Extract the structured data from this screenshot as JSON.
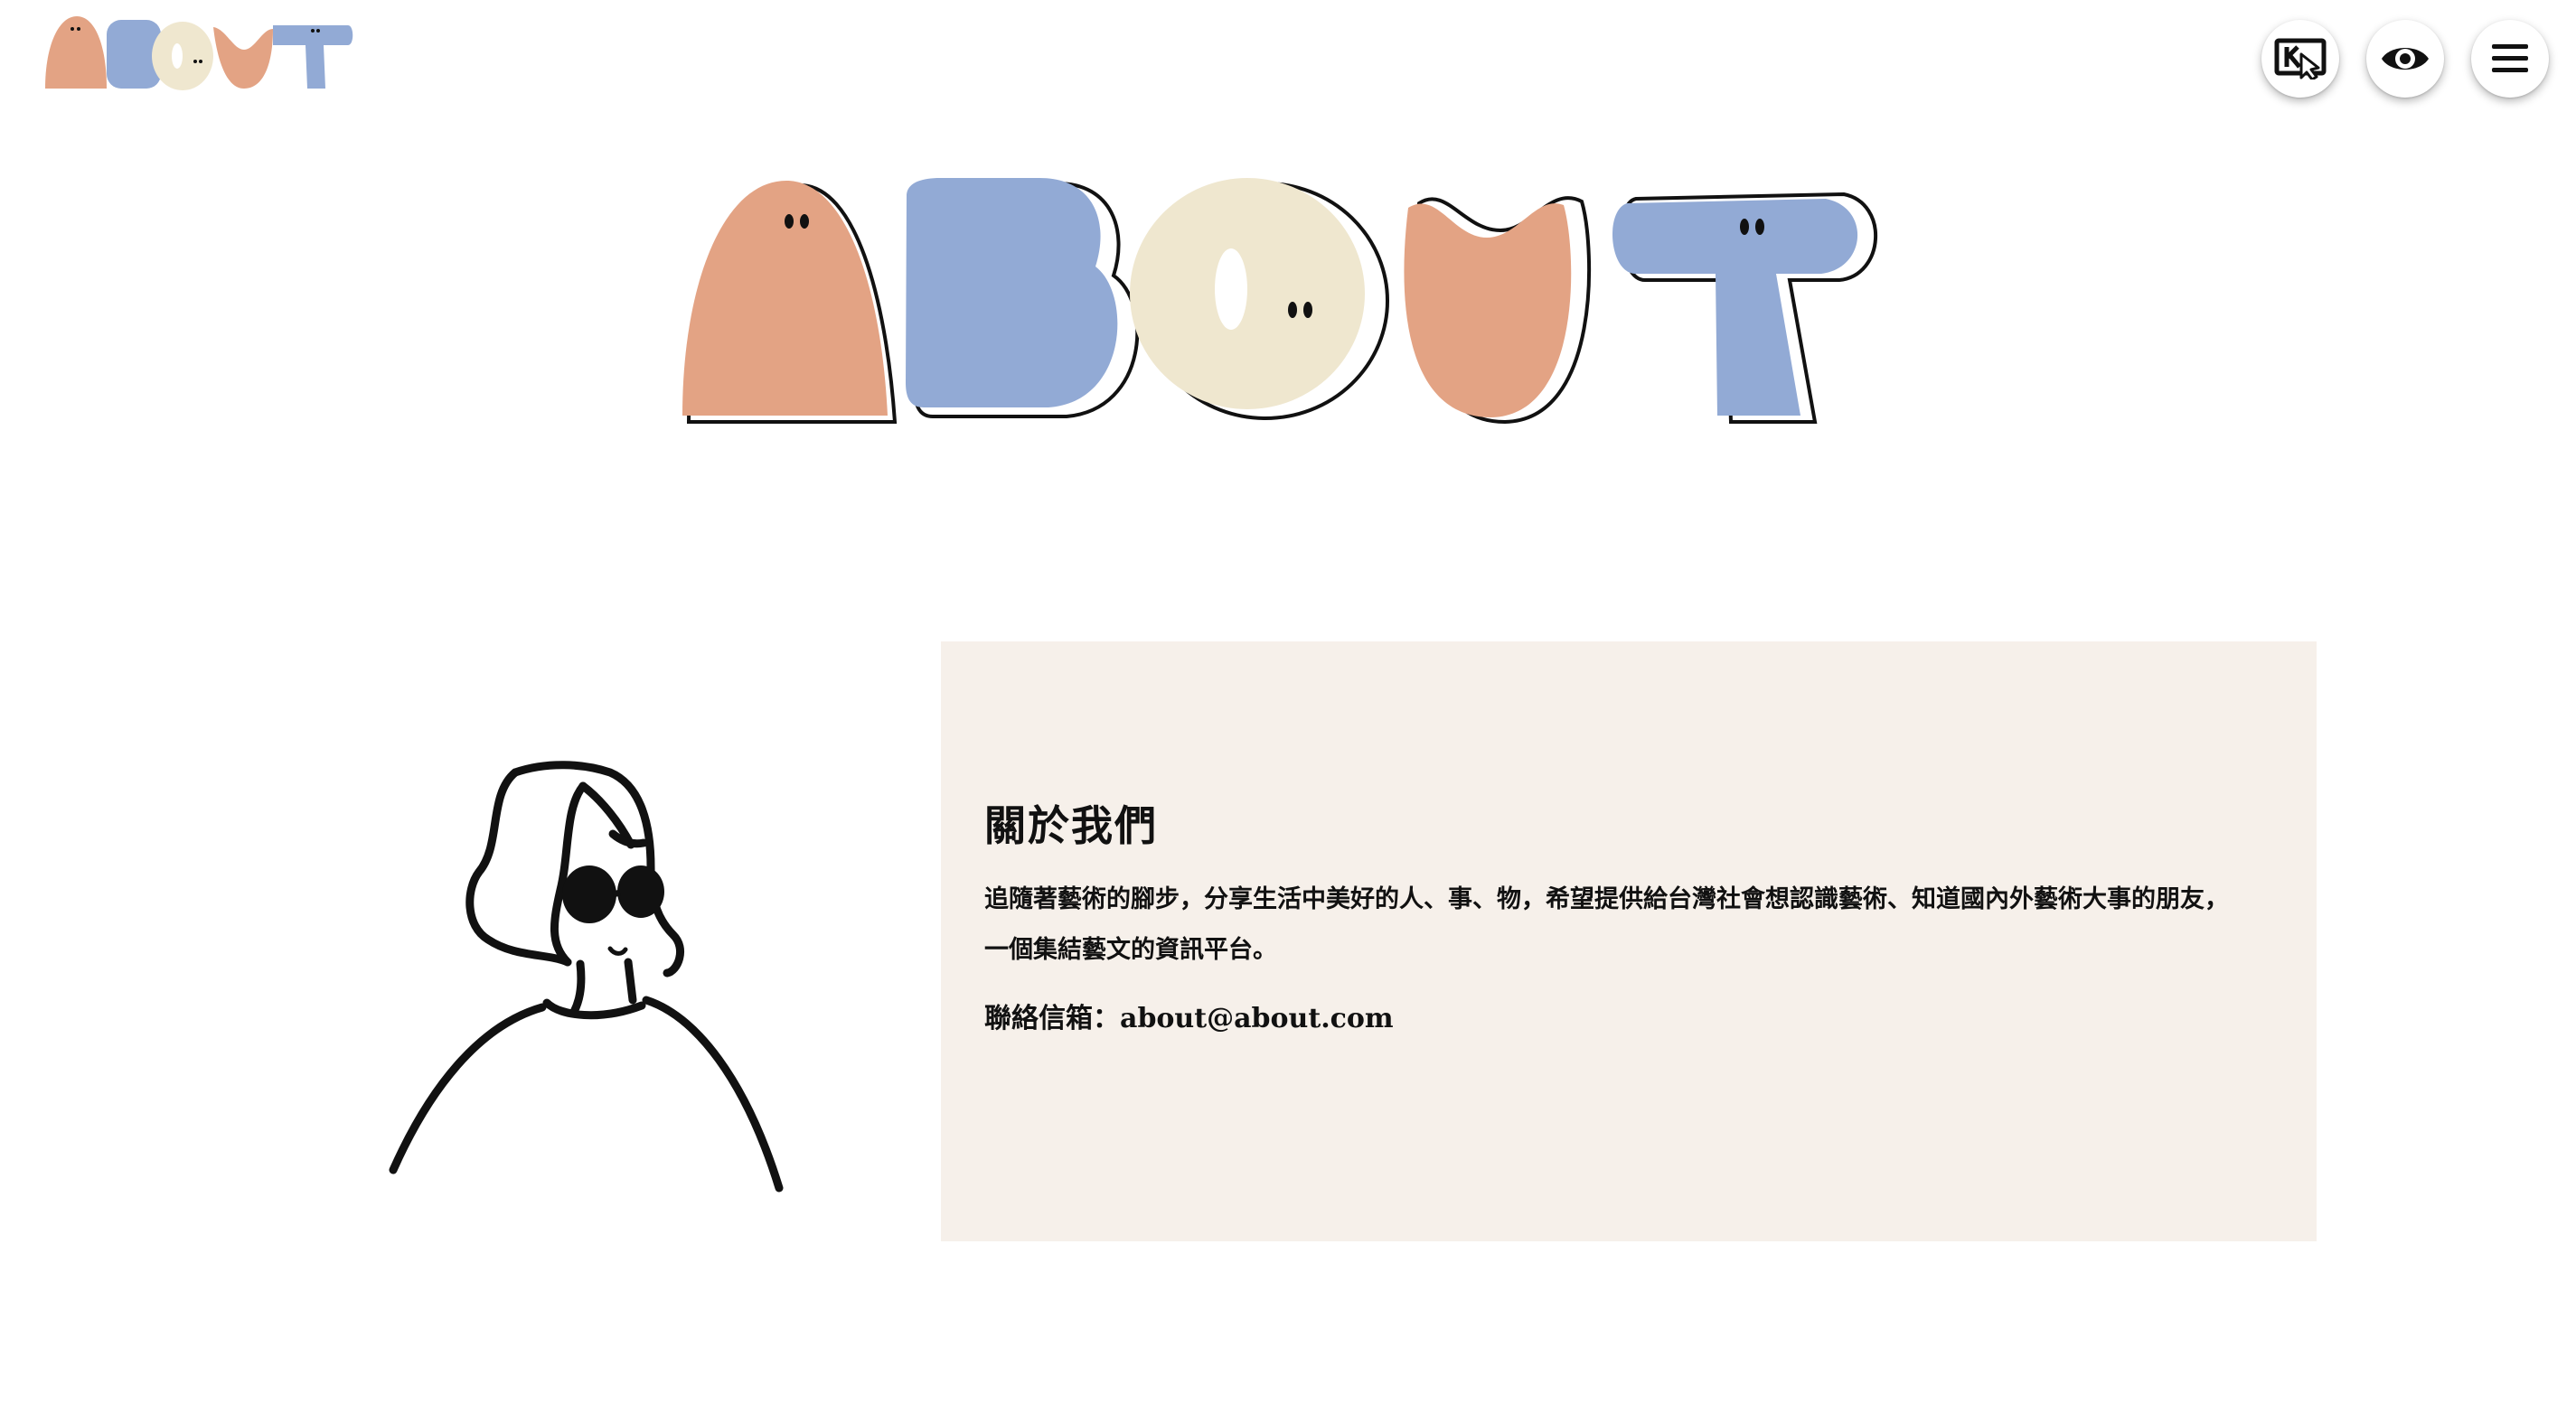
{
  "logo": {
    "text": "ABOUT"
  },
  "header": {
    "buttons": [
      {
        "name": "exit-fullscreen-button",
        "icon": "cursor-in-box-icon"
      },
      {
        "name": "view-button",
        "icon": "eye-icon"
      },
      {
        "name": "menu-button",
        "icon": "hamburger-menu-icon"
      }
    ]
  },
  "hero": {
    "title": "ABOUT"
  },
  "about": {
    "heading": "關於我們",
    "description_line1": "追隨著藝術的腳步，分享生活中美好的人、事、物，希望提供給台灣社會想認識藝術、知道國內外藝術大事的朋友，",
    "description_line2": "一個集結藝文的資訊平台。",
    "contact_label": "聯絡信箱：",
    "contact_email": "about@about.com"
  },
  "colors": {
    "peach": "#e3a384",
    "blue": "#92aad5",
    "cream": "#efe7cf",
    "card_background": "#f6f0ea",
    "ink": "#111111"
  }
}
